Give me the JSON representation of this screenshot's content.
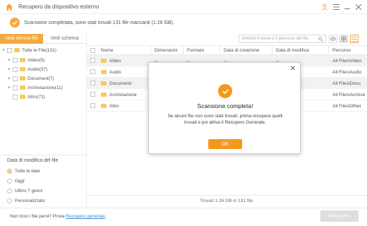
{
  "app": {
    "title": "Recupero da dispositivo esterno",
    "accent": "#f39a1e"
  },
  "status": {
    "message": "Scansione completata, sono stati trovati 131 file mancanti (1.26 GB)."
  },
  "tabs": [
    {
      "label": "Vedi elenco file",
      "active": true
    },
    {
      "label": "Vedi schema",
      "active": false
    }
  ],
  "tree": [
    {
      "label": "Tutte le File(131)"
    },
    {
      "label": "Video(5)"
    },
    {
      "label": "Audio(37)"
    },
    {
      "label": "Document(7)"
    },
    {
      "label": "Archiviazione(11)"
    },
    {
      "label": "Altro(71)"
    }
  ],
  "filter": {
    "title": "Data di modifica del file",
    "options": [
      "Tutte le date",
      "Oggi",
      "Ultimi 7 giorni",
      "Personalizzato"
    ],
    "selected": "Tutte le date"
  },
  "search": {
    "placeholder": "Immetti il nome o il percorso del file"
  },
  "table": {
    "columns": [
      "Nome",
      "Dimensioni",
      "Formato",
      "Data di creazione",
      "Data di modifica",
      "Percorso"
    ],
    "rows": [
      {
        "name": "Video",
        "size": "--",
        "format": "--",
        "created": "--",
        "modified": "--",
        "path": "All Files\\Video"
      },
      {
        "name": "Audio",
        "size": "",
        "format": "",
        "created": "",
        "modified": "",
        "path": "All Files\\Audio"
      },
      {
        "name": "Documenti",
        "size": "",
        "format": "",
        "created": "",
        "modified": "",
        "path": "All Files\\Docu"
      },
      {
        "name": "Archiviazione",
        "size": "",
        "format": "",
        "created": "",
        "modified": "",
        "path": "All Files\\Archive"
      },
      {
        "name": "Altro",
        "size": "",
        "format": "",
        "created": "",
        "modified": "",
        "path": "All Files\\Other"
      }
    ]
  },
  "footer": {
    "count": "Trovati 1.26 GB in 131 file.",
    "help_prefix": "Non trovi i file persi? Prova ",
    "help_link": "Recupero generale",
    "help_suffix": ".",
    "recover_label": "Recupero"
  },
  "modal": {
    "title": "Scansione completa!",
    "message": "Se alcuni file non sono stati trovati, prima recupera quelli trovati e poi attiva il Recupero Generale.",
    "ok_label": "OK"
  }
}
